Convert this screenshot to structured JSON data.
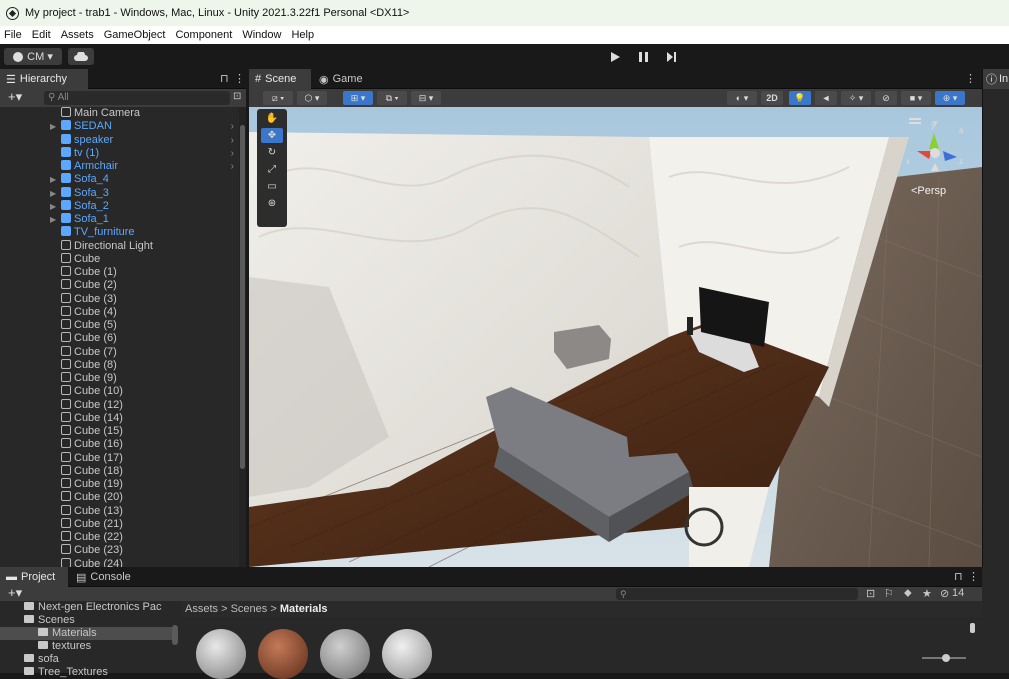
{
  "window": {
    "title": "My project - trab1 - Windows, Mac, Linux - Unity 2021.3.22f1 Personal <DX11>"
  },
  "menu": [
    "File",
    "Edit",
    "Assets",
    "GameObject",
    "Component",
    "Window",
    "Help"
  ],
  "toolbar": {
    "account_label": "CM ▾",
    "cloud_icon": "cloud-icon",
    "play_controls": [
      "play-icon",
      "pause-icon",
      "step-icon"
    ]
  },
  "hierarchy": {
    "tab_label": "Hierarchy",
    "search_placeholder": "All",
    "items": [
      {
        "label": "Main Camera",
        "prefab": false,
        "expander": false,
        "child_arrow": false
      },
      {
        "label": "SEDAN",
        "prefab": true,
        "expander": true,
        "child_arrow": true
      },
      {
        "label": "speaker",
        "prefab": true,
        "expander": false,
        "child_arrow": true
      },
      {
        "label": "tv (1)",
        "prefab": true,
        "expander": false,
        "child_arrow": true
      },
      {
        "label": "Armchair",
        "prefab": true,
        "expander": false,
        "child_arrow": true
      },
      {
        "label": "Sofa_4",
        "prefab": true,
        "expander": true,
        "child_arrow": false
      },
      {
        "label": "Sofa_3",
        "prefab": true,
        "expander": true,
        "child_arrow": false
      },
      {
        "label": "Sofa_2",
        "prefab": true,
        "expander": true,
        "child_arrow": false
      },
      {
        "label": "Sofa_1",
        "prefab": true,
        "expander": true,
        "child_arrow": false
      },
      {
        "label": "TV_furniture",
        "prefab": true,
        "expander": false,
        "child_arrow": false
      },
      {
        "label": "Directional Light",
        "prefab": false,
        "expander": false,
        "child_arrow": false
      },
      {
        "label": "Cube",
        "prefab": false
      },
      {
        "label": "Cube (1)",
        "prefab": false
      },
      {
        "label": "Cube (2)",
        "prefab": false
      },
      {
        "label": "Cube (3)",
        "prefab": false
      },
      {
        "label": "Cube (4)",
        "prefab": false
      },
      {
        "label": "Cube (5)",
        "prefab": false
      },
      {
        "label": "Cube (6)",
        "prefab": false
      },
      {
        "label": "Cube (7)",
        "prefab": false
      },
      {
        "label": "Cube (8)",
        "prefab": false
      },
      {
        "label": "Cube (9)",
        "prefab": false
      },
      {
        "label": "Cube (10)",
        "prefab": false
      },
      {
        "label": "Cube (12)",
        "prefab": false
      },
      {
        "label": "Cube (14)",
        "prefab": false
      },
      {
        "label": "Cube (15)",
        "prefab": false
      },
      {
        "label": "Cube (16)",
        "prefab": false
      },
      {
        "label": "Cube (17)",
        "prefab": false
      },
      {
        "label": "Cube (18)",
        "prefab": false
      },
      {
        "label": "Cube (19)",
        "prefab": false
      },
      {
        "label": "Cube (20)",
        "prefab": false
      },
      {
        "label": "Cube (13)",
        "prefab": false
      },
      {
        "label": "Cube (21)",
        "prefab": false
      },
      {
        "label": "Cube (22)",
        "prefab": false
      },
      {
        "label": "Cube (23)",
        "prefab": false
      },
      {
        "label": "Cube (24)",
        "prefab": false
      }
    ]
  },
  "scene": {
    "tabs": [
      "Scene",
      "Game"
    ],
    "toggle_2d": "2D",
    "persp_label": "<Persp",
    "gizmo_axes": {
      "x": "x",
      "y": "y",
      "z": "z"
    },
    "tools": [
      "hand-tool",
      "move-tool",
      "rotate-tool",
      "scale-tool",
      "rect-tool",
      "transform-tool"
    ]
  },
  "inspector": {
    "tab_label": "In"
  },
  "project": {
    "tabs": [
      "Project",
      "Console"
    ],
    "hidden_count": "14",
    "tree": [
      {
        "label": "Next-gen Electronics Pac",
        "indent": 1,
        "selected": false
      },
      {
        "label": "Scenes",
        "indent": 1,
        "selected": false
      },
      {
        "label": "Materials",
        "indent": 2,
        "selected": true
      },
      {
        "label": "textures",
        "indent": 2,
        "selected": false
      },
      {
        "label": "sofa",
        "indent": 1,
        "selected": false
      },
      {
        "label": "Tree_Textures",
        "indent": 1,
        "selected": false
      }
    ],
    "breadcrumb": [
      "Assets",
      "Scenes",
      "Materials"
    ]
  },
  "colors": {
    "prefab_blue": "#5ca8ff",
    "selected_tool": "#3a76c9",
    "floor_wood": "#5a3420",
    "wall": "#e8e6e1",
    "ground": "#6e6156"
  }
}
